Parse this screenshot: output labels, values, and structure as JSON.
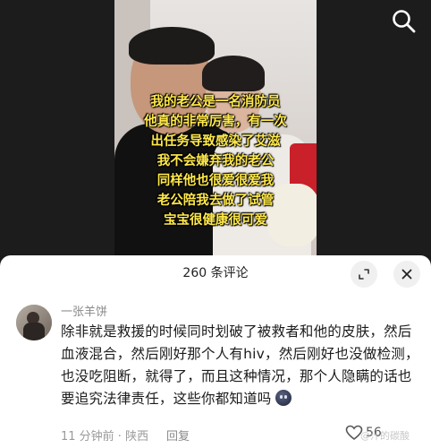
{
  "video": {
    "caption_lines": [
      "我的老公是一名消防员",
      "他真的非常厉害，有一次",
      "出任务导致感染了艾滋",
      "我不会嫌弃我的老公",
      "同样他也很爱很爱我",
      "老公陪我去做了试管",
      "宝宝很健康很可爱"
    ],
    "caption_color": "#ffe94a",
    "search_icon": "search-icon"
  },
  "comments": {
    "title": "260 条评论",
    "expand_icon": "expand-icon",
    "close_icon": "close-icon",
    "items": [
      {
        "username": "一张羊饼",
        "text": "除非就是救援的时候同时划破了被救者和他的皮肤，然后血液混合，然后刚好那个人有hiv，然后刚好也没做检测，也没吃阻断，就得了，而且这种情况，那个人隐瞒的话也要追究法律责任，这些你都知道吗",
        "emoji_icon": "worried-face-emoji-icon",
        "time": "11 分钟前 · 陕西",
        "reply_label": "回复",
        "like_count": "56",
        "like_icon": "heart-icon"
      }
    ]
  },
  "watermark": "@汁的碳酸"
}
